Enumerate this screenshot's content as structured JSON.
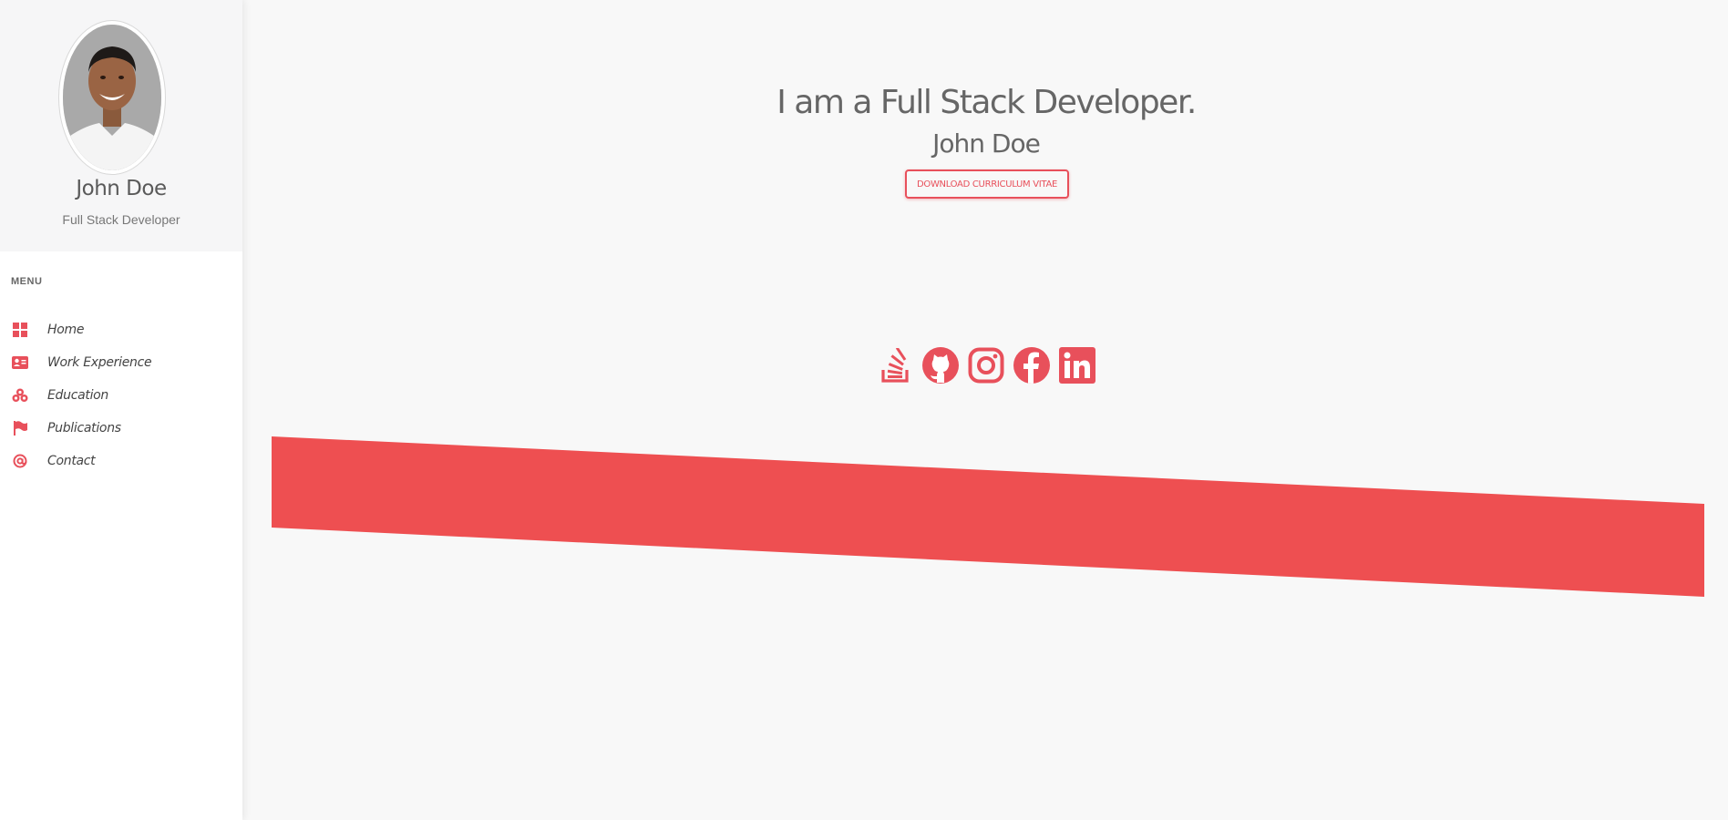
{
  "profile": {
    "name": "John Doe",
    "role": "Full Stack Developer"
  },
  "menu": {
    "heading": "MENU",
    "items": [
      {
        "label": "Home",
        "icon": "dashboard-icon"
      },
      {
        "label": "Work Experience",
        "icon": "id-card-icon"
      },
      {
        "label": "Education",
        "icon": "cubes-icon"
      },
      {
        "label": "Publications",
        "icon": "flag-icon"
      },
      {
        "label": "Contact",
        "icon": "at-icon"
      }
    ]
  },
  "hero": {
    "headline": "I am a Full Stack Developer.",
    "name": "John Doe",
    "cv_button_label": "DOWNLOAD CURRICULUM VITAE"
  },
  "socials": [
    {
      "name": "stackoverflow-icon"
    },
    {
      "name": "github-icon"
    },
    {
      "name": "instagram-icon"
    },
    {
      "name": "facebook-icon"
    },
    {
      "name": "linkedin-icon"
    }
  ],
  "colors": {
    "accent": "#e8505b",
    "sidebar_bg": "#ffffff",
    "profile_bg": "#f6f6f7",
    "page_bg": "#f8f8f8",
    "text": "#666666"
  }
}
